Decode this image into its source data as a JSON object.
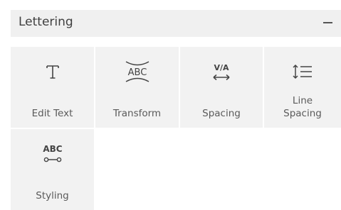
{
  "panel": {
    "title": "Lettering",
    "collapse_icon": "minus-icon"
  },
  "tools": [
    {
      "label": "Edit Text",
      "icon": "text-t-icon"
    },
    {
      "label": "Transform",
      "icon": "text-transform-icon",
      "icon_text": "ABC"
    },
    {
      "label": "Spacing",
      "icon": "letter-spacing-icon",
      "icon_text": "V/A"
    },
    {
      "label_line1": "Line",
      "label_line2": "Spacing",
      "icon": "line-spacing-icon"
    },
    {
      "label": "Styling",
      "icon": "text-styling-icon",
      "icon_text": "ABC"
    }
  ]
}
